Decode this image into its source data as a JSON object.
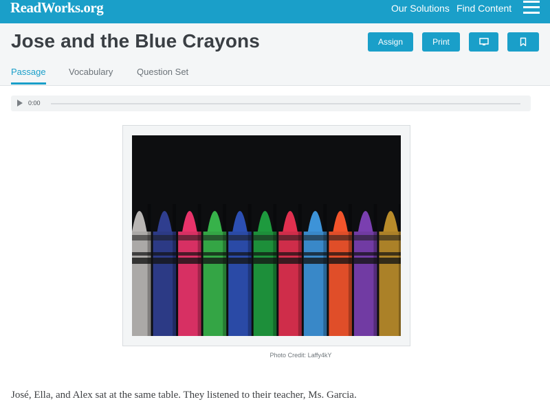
{
  "brand": {
    "logo_text": "ReadWorks.org",
    "primary_color": "#1a9fc9"
  },
  "nav": {
    "solutions_label": "Our Solutions",
    "find_content_label": "Find Content",
    "menu_icon": "hamburger-menu-icon"
  },
  "article": {
    "title": "Jose and the Blue Crayons",
    "actions": {
      "assign_label": "Assign",
      "print_label": "Print",
      "present_icon": "monitor-icon",
      "bookmark_icon": "bookmark-icon"
    },
    "tabs": [
      {
        "label": "Passage",
        "active": true
      },
      {
        "label": "Vocabulary",
        "active": false
      },
      {
        "label": "Question Set",
        "active": false
      }
    ]
  },
  "audio": {
    "time": "0:00",
    "progress": 0
  },
  "figure": {
    "credit": "Photo Credit: Laffy4kY",
    "crayon_colors": [
      "#b9b6b4",
      "#2f3e8f",
      "#e8336a",
      "#37b24a",
      "#2c4fb3",
      "#1e9a3e",
      "#e0304f",
      "#3d93d8",
      "#f2542b",
      "#7a3fb0",
      "#b88b2a"
    ]
  },
  "passage": {
    "first_line": "José, Ella, and Alex sat at the same table. They listened to their teacher, Ms. Garcia."
  }
}
